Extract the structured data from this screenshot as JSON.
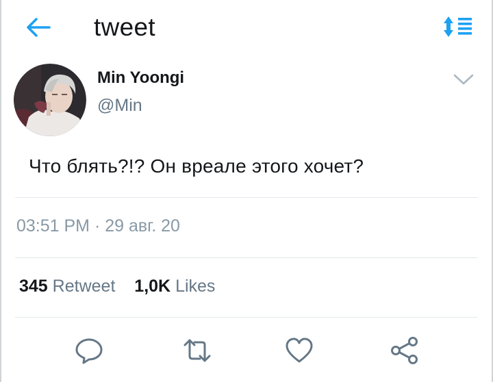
{
  "header": {
    "title": "tweet",
    "back_icon": "arrow-left-icon",
    "sort_icon": "sort-list-icon"
  },
  "tweet": {
    "author_name": "Min Yoongi",
    "author_handle": "@Min",
    "text": "Что блять?!? Он вреале этого хочет?",
    "timestamp": "03:51 PM · 29 авг. 20",
    "retweet_count": "345",
    "retweet_label": "Retweet",
    "like_count": "1,0K",
    "like_label": "Likes"
  },
  "actions": [
    "reply-icon",
    "retweet-icon",
    "like-icon",
    "share-icon"
  ],
  "colors": {
    "accent": "#1da1f2",
    "text": "#14171a",
    "secondary": "#657786",
    "muted": "#8899a6",
    "divider": "#e1e8ed"
  }
}
